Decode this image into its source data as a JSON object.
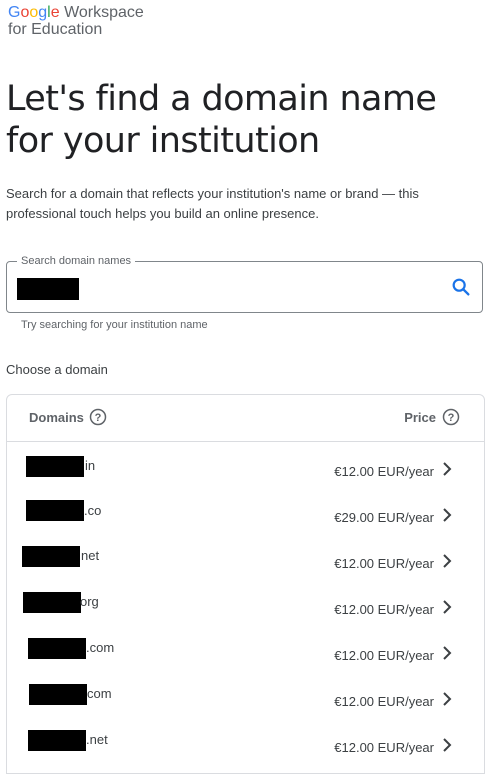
{
  "brand": {
    "google_letters": [
      {
        "ch": "G",
        "color": "#4285F4"
      },
      {
        "ch": "o",
        "color": "#EA4335"
      },
      {
        "ch": "o",
        "color": "#FBBC05"
      },
      {
        "ch": "g",
        "color": "#4285F4"
      },
      {
        "ch": "l",
        "color": "#34A853"
      },
      {
        "ch": "e",
        "color": "#EA4335"
      }
    ],
    "workspace": "Workspace",
    "subline": "for Education"
  },
  "headline": "Let's find a domain name for your institution",
  "description": "Search for a domain that reflects your institution's name or brand — this professional touch helps you build an online presence.",
  "search": {
    "label": "Search domain names",
    "value": "",
    "helper": "Try searching for your institution name",
    "icon": "search-icon",
    "accent": "#1a73e8"
  },
  "choose_label": "Choose a domain",
  "table": {
    "col_domains": "Domains",
    "col_price": "Price",
    "rows": [
      {
        "suffix": "in",
        "price": "€12.00 EUR/year"
      },
      {
        "suffix": ".co",
        "price": "€29.00 EUR/year"
      },
      {
        "suffix": "net",
        "price": "€12.00 EUR/year"
      },
      {
        "suffix": "org",
        "price": "€12.00 EUR/year"
      },
      {
        "suffix": ".com",
        "price": "€12.00 EUR/year"
      },
      {
        "suffix": "com",
        "price": "€12.00 EUR/year"
      },
      {
        "suffix": ".net",
        "price": "€12.00 EUR/year"
      }
    ]
  }
}
